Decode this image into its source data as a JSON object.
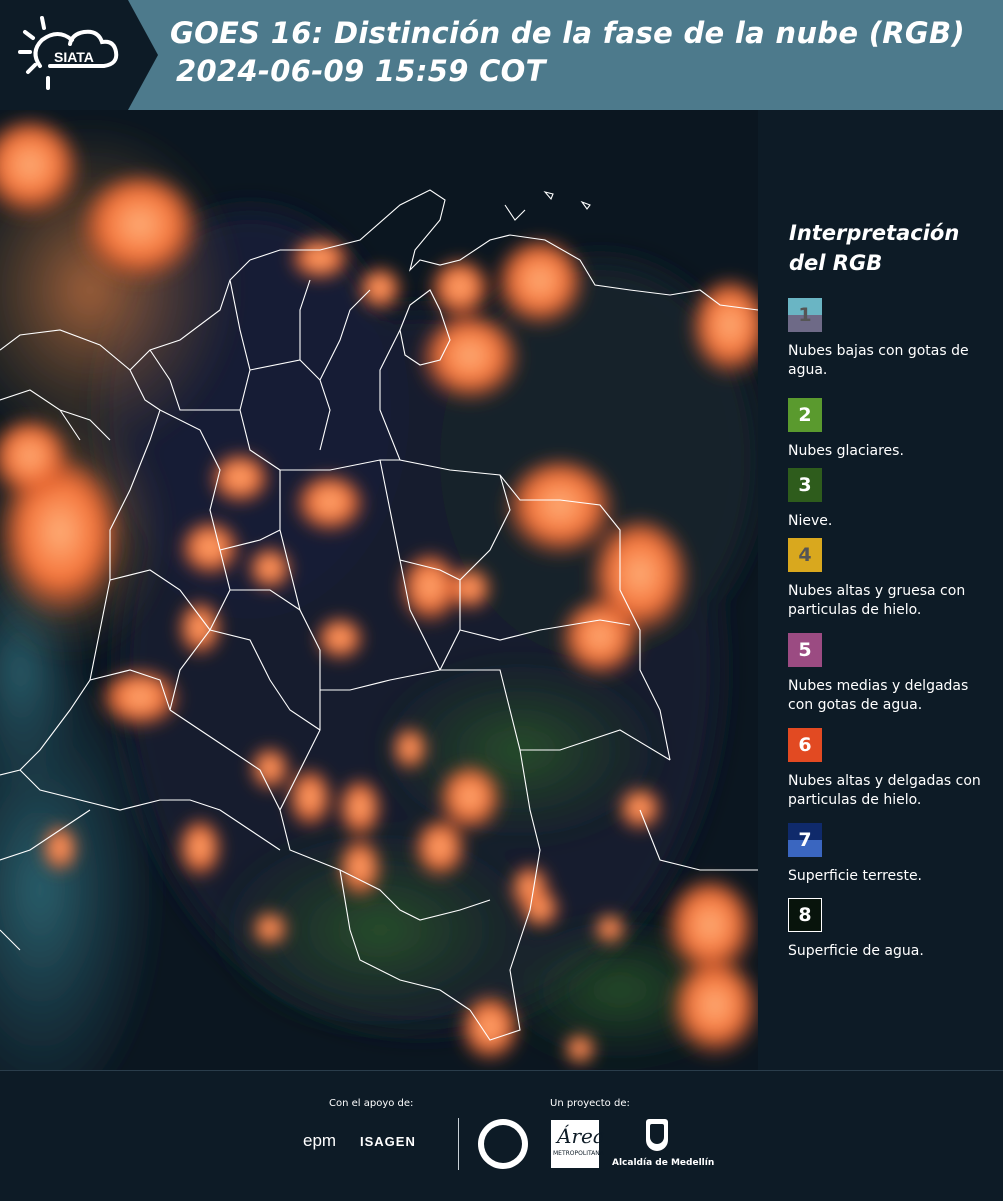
{
  "header": {
    "logo_text": "SIATA",
    "title_line1": "GOES 16: Distinción de la fase de la nube (RGB)",
    "title_line2": "2024-06-09 15:59 COT"
  },
  "map": {
    "content": "Satellite RGB composite over Colombia and surrounding region with white administrative boundaries"
  },
  "legend": {
    "title_line1": "Interpretación",
    "title_line2": "del RGB",
    "items": [
      {
        "num": "1",
        "color_top": "#6ab5c4",
        "color_bottom": "#6e6a87",
        "num_color": "#555555",
        "text": "Nubes bajas con gotas de agua."
      },
      {
        "num": "2",
        "color_top": "#5a9a2e",
        "color_bottom": "#5a9a2e",
        "num_color": "#ffffff",
        "text": "Nubes glaciares."
      },
      {
        "num": "3",
        "color_top": "#2e5c1c",
        "color_bottom": "#2e5c1c",
        "num_color": "#ffffff",
        "text": "Nieve."
      },
      {
        "num": "4",
        "color_top": "#d9a81e",
        "color_bottom": "#d9a81e",
        "num_color": "#555555",
        "text": "Nubes altas y gruesa con particulas de hielo."
      },
      {
        "num": "5",
        "color_top": "#9b4b82",
        "color_bottom": "#9b4b82",
        "num_color": "#ffffff",
        "text": "Nubes medias y delgadas con gotas de agua."
      },
      {
        "num": "6",
        "color_top": "#e24a22",
        "color_bottom": "#e24a22",
        "num_color": "#ffffff",
        "text": "Nubes altas y delgadas con particulas de hielo."
      },
      {
        "num": "7",
        "color_top": "#0f2a6b",
        "color_bottom": "#3a66c0",
        "num_color": "#ffffff",
        "text": "Superficie terreste."
      },
      {
        "num": "8",
        "color_top": "#08140c",
        "color_bottom": "#08140c",
        "num_color": "#ffffff",
        "text": "Superficie de agua."
      }
    ]
  },
  "footer": {
    "support_label": "Con el apoyo de:",
    "project_label": "Un proyecto de:",
    "epm": "epm",
    "isagen": "ISAGEN",
    "area_letter": "Área",
    "area_sub": "METROPOLITANA",
    "alcaldia": "Alcaldía de Medellín"
  }
}
